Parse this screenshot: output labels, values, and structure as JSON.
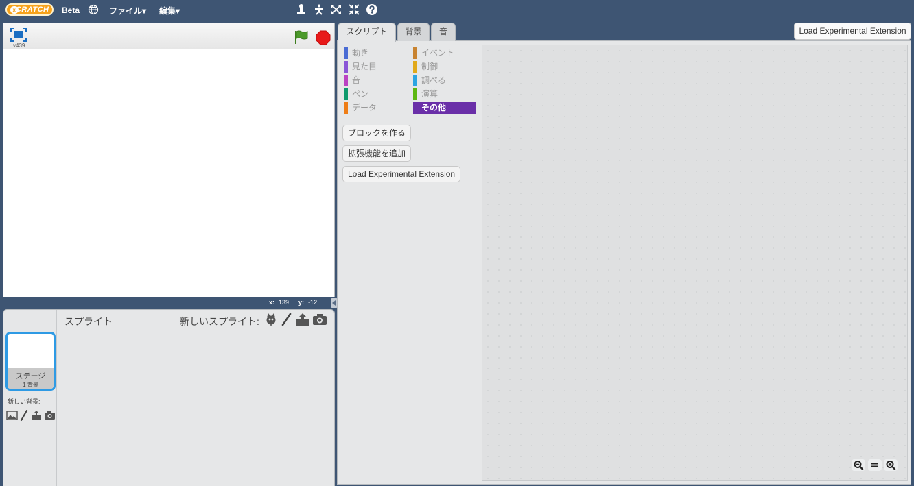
{
  "topbar": {
    "logo_text": "SCRATCH",
    "logo_badge": "x",
    "beta": "Beta",
    "menu_file": "ファイル▾",
    "menu_edit": "編集▾",
    "icons": [
      "duplicate-icon",
      "cut-icon",
      "grow-icon",
      "shrink-icon",
      "help-icon"
    ]
  },
  "stage": {
    "version": "v439",
    "coord_x_label": "x:",
    "coord_x": "139",
    "coord_y_label": "y:",
    "coord_y": "-12"
  },
  "sprites": {
    "title": "スプライト",
    "new_sprite_label": "新しいスプライト:",
    "stage_name": "ステージ",
    "stage_backdrops": "1 背景",
    "new_backdrop_label": "新しい背景:"
  },
  "tabs": [
    {
      "label": "スクリプト",
      "active": true
    },
    {
      "label": "背景",
      "active": false
    },
    {
      "label": "音",
      "active": false
    }
  ],
  "load_extension_top": "Load Experimental Extension",
  "categories_left": [
    {
      "label": "動き",
      "color": "#4a6cd4"
    },
    {
      "label": "見た目",
      "color": "#8a55d7"
    },
    {
      "label": "音",
      "color": "#bb42c3"
    },
    {
      "label": "ペン",
      "color": "#0e9a6c"
    },
    {
      "label": "データ",
      "color": "#ee7d16"
    }
  ],
  "categories_right": [
    {
      "label": "イベント",
      "color": "#c88330"
    },
    {
      "label": "制御",
      "color": "#e1a91a"
    },
    {
      "label": "調べる",
      "color": "#2ca5e2"
    },
    {
      "label": "演算",
      "color": "#5cb712"
    },
    {
      "label": "その他",
      "color": "#632d99",
      "selected": true
    }
  ],
  "palette_buttons": {
    "make_block": "ブロックを作る",
    "add_extension": "拡張機能を追加",
    "load_extension": "Load Experimental Extension"
  },
  "colors": {
    "topbar": "#3e5573",
    "selected_tab_outline": "#2e9ae4"
  }
}
